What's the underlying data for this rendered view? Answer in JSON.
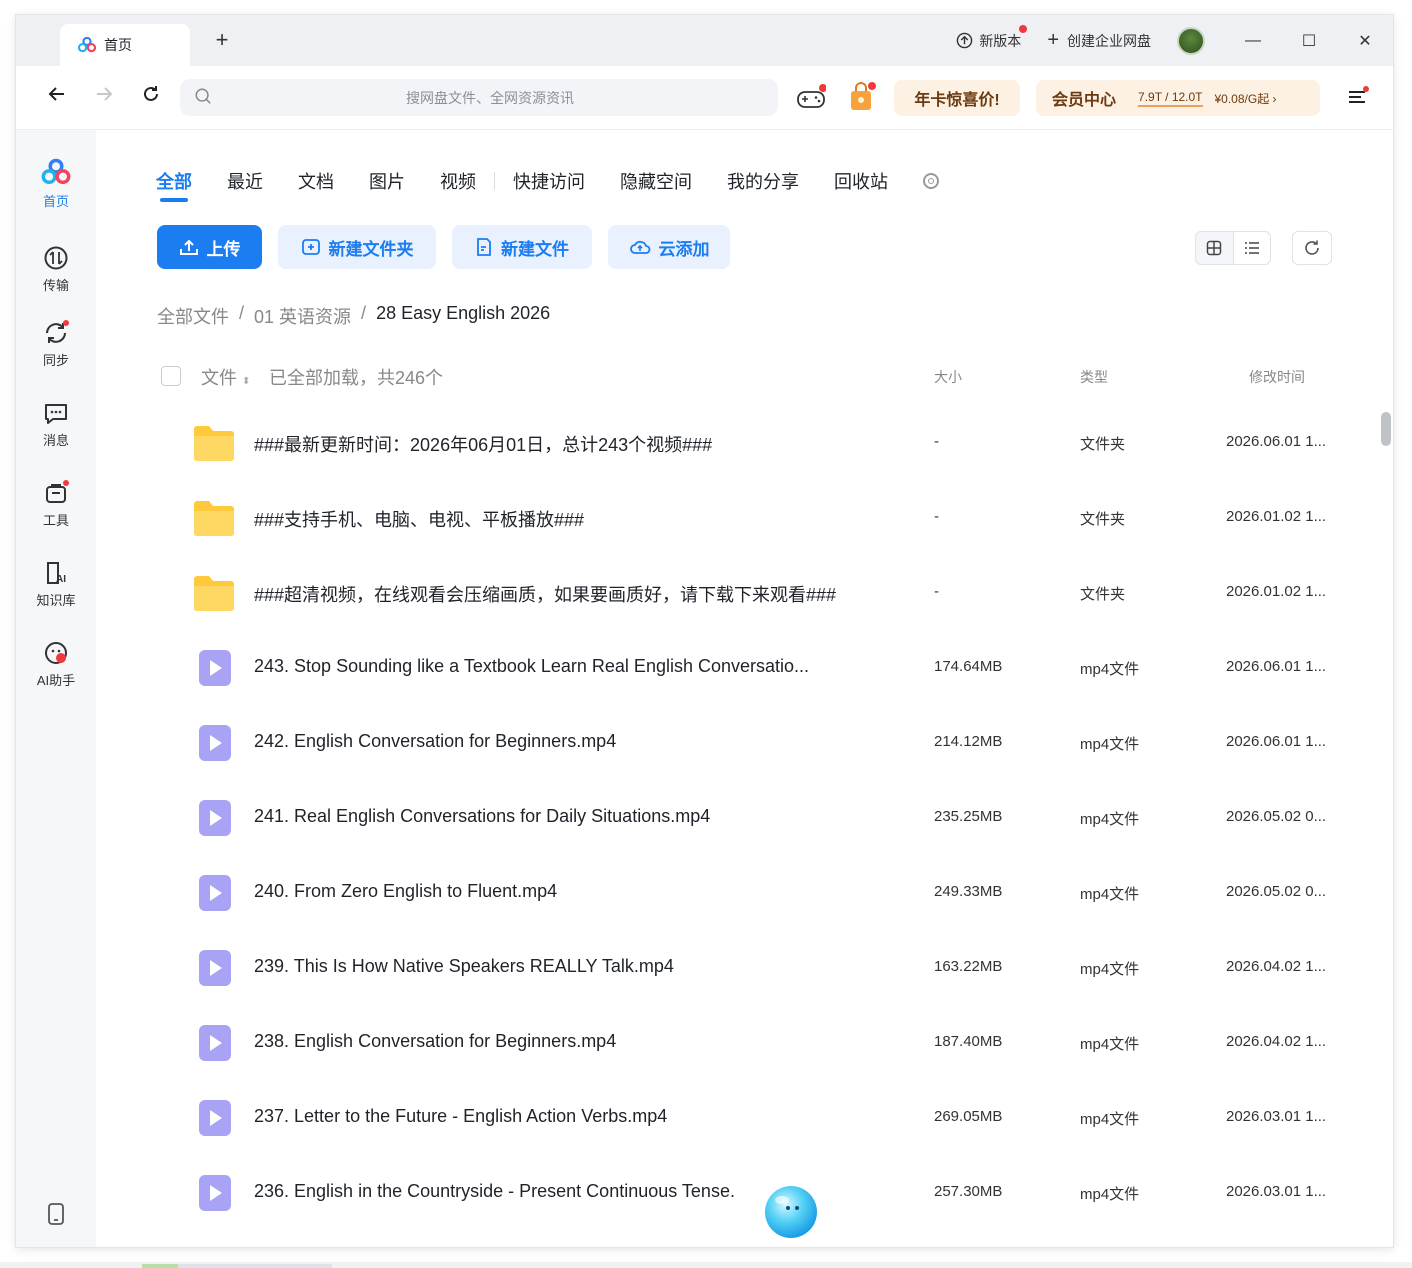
{
  "titlebar": {
    "tab_label": "首页",
    "new_tab": "+",
    "new_version": "新版本",
    "create_enterprise": "创建企业网盘",
    "minimize": "—",
    "maximize": "☐",
    "close": "✕"
  },
  "addressbar": {
    "search_placeholder": "搜网盘文件、全网资源资讯",
    "promo": "年卡惊喜价!",
    "vip_title": "会员中心",
    "vip_storage": "7.9T / 12.0T",
    "vip_price": "¥0.08/G起 ›"
  },
  "sidebar": {
    "items": [
      {
        "label": "首页",
        "icon": "home-logo-icon"
      },
      {
        "label": "传输",
        "icon": "transfer-icon"
      },
      {
        "label": "同步",
        "icon": "sync-icon"
      },
      {
        "label": "消息",
        "icon": "message-icon"
      },
      {
        "label": "工具",
        "icon": "tools-icon"
      },
      {
        "label": "知识库",
        "icon": "knowledge-icon"
      },
      {
        "label": "AI助手",
        "icon": "ai-assistant-icon"
      }
    ]
  },
  "categories": [
    "全部",
    "最近",
    "文档",
    "图片",
    "视频",
    "快捷访问",
    "隐藏空间",
    "我的分享",
    "回收站"
  ],
  "actions": {
    "upload": "上传",
    "new_folder": "新建文件夹",
    "new_file": "新建文件",
    "cloud_add": "云添加"
  },
  "breadcrumb": [
    "全部文件",
    "/",
    "01 英语资源",
    "/",
    "28 Easy English 2026"
  ],
  "table": {
    "col_file": "文件",
    "loaded_text": "已全部加载，共246个",
    "col_size": "大小",
    "col_type": "类型",
    "col_time": "修改时间",
    "rows": [
      {
        "kind": "folder",
        "name": "###最新更新时间：2026年06月01日，总计243个视频###",
        "size": "-",
        "type": "文件夹",
        "time": "2026.06.01 1..."
      },
      {
        "kind": "folder",
        "name": "###支持手机、电脑、电视、平板播放###",
        "size": "-",
        "type": "文件夹",
        "time": "2026.01.02 1..."
      },
      {
        "kind": "folder",
        "name": "###超清视频，在线观看会压缩画质，如果要画质好，请下载下来观看###",
        "size": "-",
        "type": "文件夹",
        "time": "2026.01.02 1..."
      },
      {
        "kind": "video",
        "name": "243. Stop Sounding like a Textbook Learn Real English Conversatio...",
        "size": "174.64MB",
        "type": "mp4文件",
        "time": "2026.06.01 1..."
      },
      {
        "kind": "video",
        "name": "242. English Conversation for Beginners.mp4",
        "size": "214.12MB",
        "type": "mp4文件",
        "time": "2026.06.01 1..."
      },
      {
        "kind": "video",
        "name": "241. Real English Conversations for Daily Situations.mp4",
        "size": "235.25MB",
        "type": "mp4文件",
        "time": "2026.05.02 0..."
      },
      {
        "kind": "video",
        "name": "240. From Zero English to Fluent.mp4",
        "size": "249.33MB",
        "type": "mp4文件",
        "time": "2026.05.02 0..."
      },
      {
        "kind": "video",
        "name": "239. This Is How Native Speakers REALLY Talk.mp4",
        "size": "163.22MB",
        "type": "mp4文件",
        "time": "2026.04.02 1..."
      },
      {
        "kind": "video",
        "name": "238. English Conversation for Beginners.mp4",
        "size": "187.40MB",
        "type": "mp4文件",
        "time": "2026.04.02 1..."
      },
      {
        "kind": "video",
        "name": "237. Letter to the Future - English Action Verbs.mp4",
        "size": "269.05MB",
        "type": "mp4文件",
        "time": "2026.03.01 1..."
      },
      {
        "kind": "video",
        "name": "236. English in the Countryside - Present Continuous Tense.",
        "size": "257.30MB",
        "type": "mp4文件",
        "time": "2026.03.01 1..."
      }
    ]
  },
  "colors": {
    "accent": "#1c7df1",
    "folder": "#ffc93c",
    "video": "#a9a3f5",
    "badge_red": "#f2383c"
  }
}
